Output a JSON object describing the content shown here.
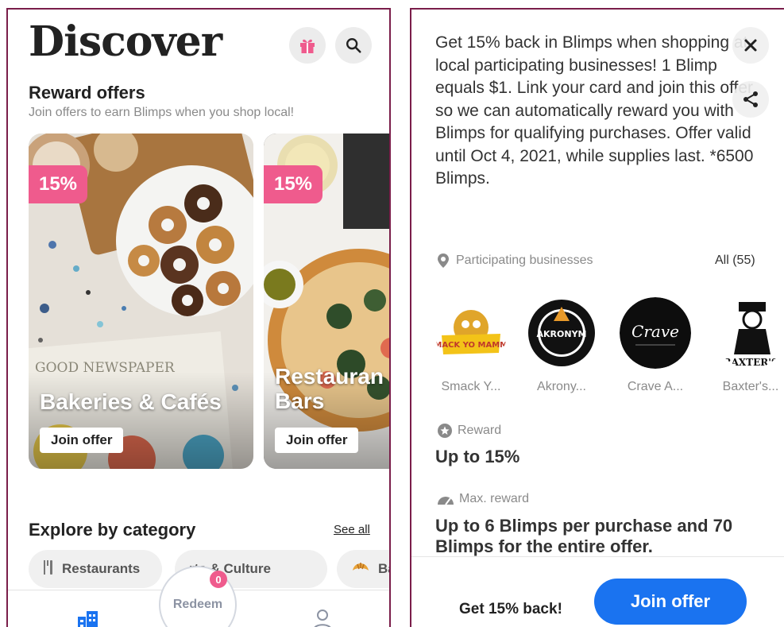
{
  "discover": {
    "title": "Discover",
    "reward_offers": {
      "title": "Reward offers",
      "subtitle": "Join offers to earn Blimps when you shop local!"
    },
    "cards": [
      {
        "badge": "15%",
        "title": "Bakeries & Cafés",
        "button": "Join offer",
        "newspaper_text": "GOOD NEWSPAPER"
      },
      {
        "badge": "15%",
        "title": "Restauran Bars",
        "title_line1": "Restauran",
        "title_line2": "Bars",
        "button": "Join offer"
      }
    ],
    "explore": {
      "title": "Explore by category",
      "see_all": "See all",
      "chips": [
        "Restaurants",
        "rts & Culture",
        "Ba"
      ]
    },
    "nav": {
      "redeem_label": "Redeem",
      "redeem_count": "0"
    }
  },
  "offer": {
    "description": "Get 15% back in Blimps when shopping at local participating businesses! 1 Blimp equals $1. Link your card and join this offer so we can automatically reward you with Blimps for qualifying purchases. Offer valid until Oct 4, 2021, while supplies last. *6500 Blimps.",
    "participating_label": "Participating businesses",
    "all_label": "All (55)",
    "businesses": [
      {
        "name": "Smack Y...",
        "logo_text": "SMACK YO MAMMA"
      },
      {
        "name": "Akrony...",
        "logo_text": "AKRONYM"
      },
      {
        "name": "Crave A...",
        "logo_text": "Crave"
      },
      {
        "name": "Baxter's...",
        "logo_text": "BAXTER'S"
      }
    ],
    "reward_label": "Reward",
    "reward_value": "Up to 15%",
    "max_label": "Max. reward",
    "max_value": "Up to 6 Blimps per purchase and 70 Blimps for the entire offer.",
    "footer_text": "Get 15% back!",
    "join_button": "Join offer"
  },
  "colors": {
    "accent_pink": "#ef5b8d",
    "primary_blue": "#1a73f0",
    "border_frame": "#7a1e4a"
  }
}
